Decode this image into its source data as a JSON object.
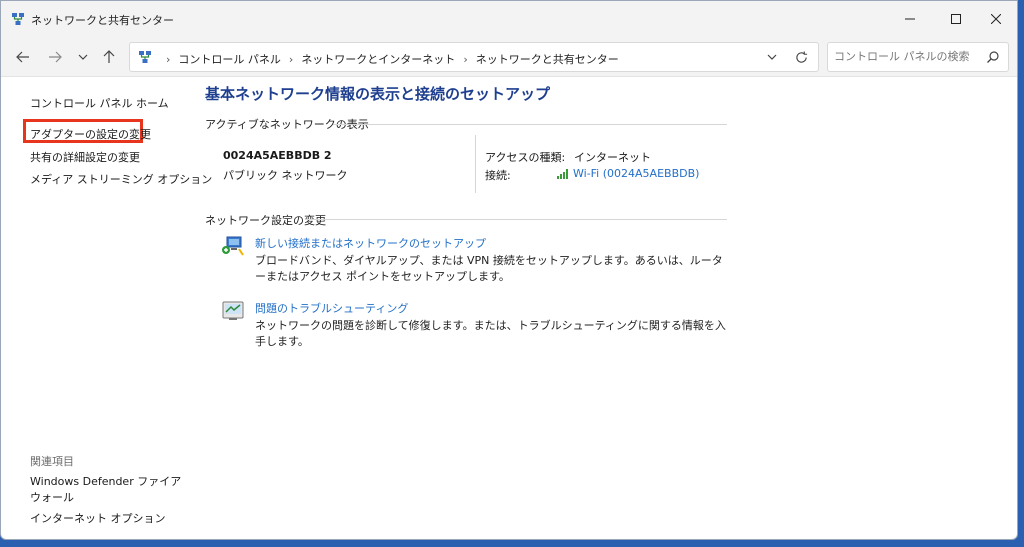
{
  "window": {
    "title": "ネットワークと共有センター"
  },
  "nav": {
    "breadcrumbs": [
      "コントロール パネル",
      "ネットワークとインターネット",
      "ネットワークと共有センター"
    ],
    "search_placeholder": "コントロール パネルの検索"
  },
  "sidebar": {
    "home": "コントロール パネル ホーム",
    "adapter": "アダプターの設定の変更",
    "sharing": "共有の詳細設定の変更",
    "media": "メディア ストリーミング オプション",
    "related_header": "関連項目",
    "defender": "Windows Defender ファイアウォール",
    "internet_options": "インターネット オプション"
  },
  "main": {
    "title": "基本ネットワーク情報の表示と接続のセットアップ",
    "active_header": "アクティブなネットワークの表示",
    "network_name": "0024A5AEBBDB 2",
    "network_type": "パブリック ネットワーク",
    "access_label": "アクセスの種類:",
    "access_value": "インターネット",
    "connection_label": "接続:",
    "connection_value": "Wi-Fi (0024A5AEBBDB)",
    "change_header": "ネットワーク設定の変更",
    "task1_link": "新しい接続またはネットワークのセットアップ",
    "task1_desc": "ブロードバンド、ダイヤルアップ、または VPN 接続をセットアップします。あるいは、ルーターまたはアクセス ポイントをセットアップします。",
    "task2_link": "問題のトラブルシューティング",
    "task2_desc": "ネットワークの問題を診断して修復します。または、トラブルシューティングに関する情報を入手します。"
  },
  "colors": {
    "link": "#2370c8",
    "title": "#1e3f8f",
    "highlight": "#e8361e"
  }
}
